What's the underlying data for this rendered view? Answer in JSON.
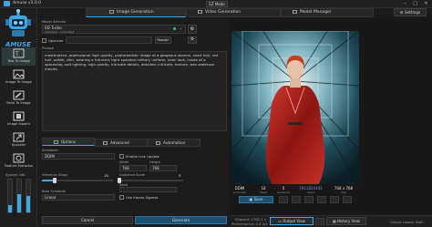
{
  "window": {
    "title": "Amuse v3.0.0",
    "mode_button": "EZ Mode",
    "settings_label": "Settings"
  },
  "brand": {
    "logo_text": "AMUSE"
  },
  "nav": [
    {
      "label": "Text To Image"
    },
    {
      "label": "Image To Image"
    },
    {
      "label": "Paint To Image"
    },
    {
      "label": "Image Inpaint"
    },
    {
      "label": "Upscaler"
    },
    {
      "label": "Feature Extractor"
    }
  ],
  "system_info": {
    "label": "System Info",
    "bars": [
      0.22,
      0.55,
      0.5
    ]
  },
  "tabs": [
    {
      "label": "Image Generation"
    },
    {
      "label": "Video Generation"
    },
    {
      "label": "Model Manager"
    }
  ],
  "model": {
    "label": "Model Selector",
    "name": "SD Turbo",
    "subname": "StabilityAI - ControlNet",
    "upscaler_label": "Upscaler",
    "status": "Ready!"
  },
  "prompt": {
    "label": "Prompt",
    "text": "masterpiece, professional high quality, photorealistic image of a gorgeous woman, short hair, red hair, petite, slim, wearing a futuristic tight spandex military uniform, neon look, inside of a spaceship, soft lighting, high quality, intricate details, detailed, intricate, texture, wes anderson movies"
  },
  "option_tabs": [
    {
      "label": "Options"
    },
    {
      "label": "Advanced"
    },
    {
      "label": "Automation"
    }
  ],
  "options": {
    "scheduler_label": "Scheduler",
    "scheduler": "DDIM",
    "live_update_label": "Enable Live Update",
    "width_label": "Width",
    "width": "768",
    "height_label": "Height",
    "height": "768",
    "steps_label": "Inference Steps",
    "steps": "18",
    "steps_fraction": 0.18,
    "guidance_label": "Guidance Scale",
    "guidance": "0",
    "guidance_fraction": 0.0,
    "seed_label": "Seed",
    "beta_label": "Beta Schedule",
    "beta": "Linear",
    "karras_label": "Use Karras Sigmas"
  },
  "actions": {
    "cancel": "Cancel",
    "generate": "Generate"
  },
  "result": {
    "stats": [
      {
        "value": "DDIM",
        "label": "Scheduler"
      },
      {
        "value": "18",
        "label": "Steps"
      },
      {
        "value": "0",
        "label": "Guidance"
      },
      {
        "value": "1913824442",
        "label": "Seed"
      },
      {
        "value": "768 x 768",
        "label": "Size"
      },
      {
        "value": "768",
        "label": ""
      }
    ],
    "save_label": "Save"
  },
  "status": {
    "elapsed": "Elapsed: 1763.1 s",
    "performance": "Performance: 0.4 it/s",
    "output_label": "Output Layout: Both"
  },
  "output_buttons": {
    "output_view": "Output View",
    "history_view": "History View"
  },
  "colors": {
    "accent": "#3fa7e3",
    "bg": "#1b1b1b",
    "panel": "#1c1c1c"
  }
}
